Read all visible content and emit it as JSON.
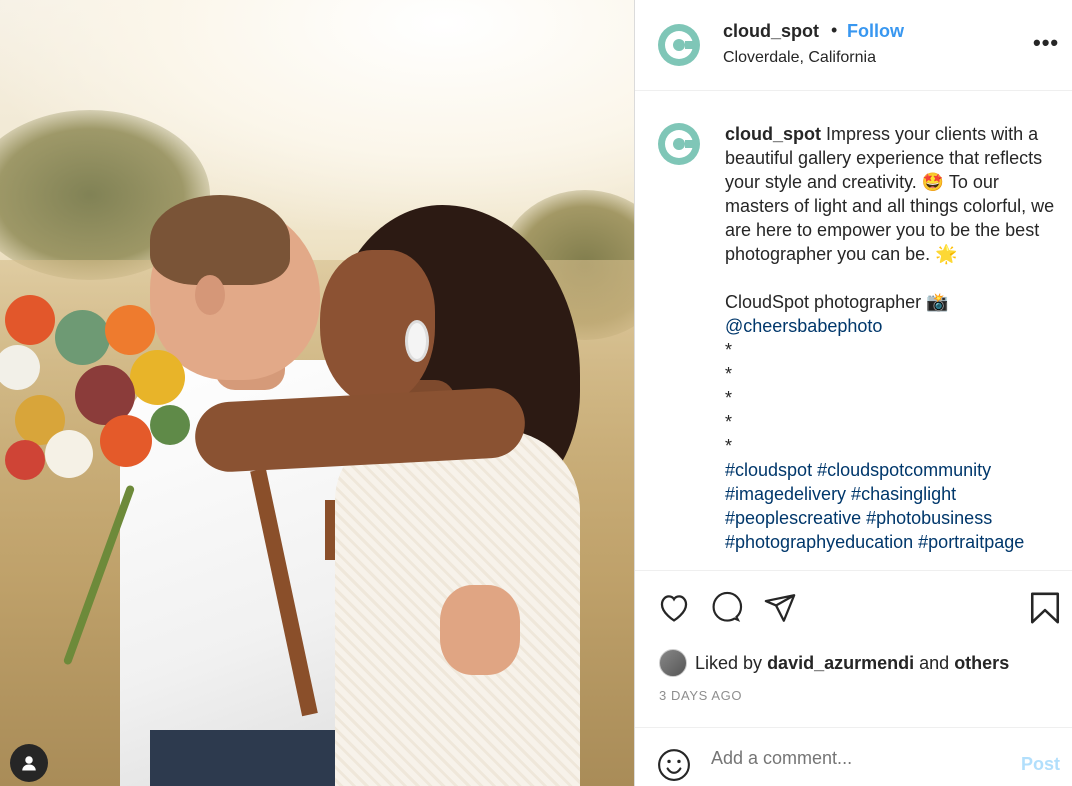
{
  "post": {
    "username": "cloud_spot",
    "separator": "•",
    "follow_label": "Follow",
    "location": "Cloverdale, California",
    "more_label": "•••"
  },
  "caption": {
    "username": "cloud_spot",
    "line1": " Impress your clients with a beautiful gallery experience that reflects your style and creativity. 🤩 To our masters of light and all things colorful, we are here to empower you to be the best photographer you can be. 🌟",
    "credit": "CloudSpot photographer 📸",
    "mention": "@cheersbabephoto",
    "stars": [
      "*",
      "*",
      "*",
      "*",
      "*"
    ],
    "hashtags": [
      "#cloudspot #cloudspotcommunity",
      "#imagedelivery #chasinglight",
      "#peoplescreative #photobusiness",
      "#photographyeducation #portraitpage"
    ]
  },
  "engagement": {
    "liked_by_prefix": "Liked by ",
    "liked_by_user": "david_azurmendi",
    "liked_by_middle": " and ",
    "liked_by_others": "others",
    "timestamp": "3 DAYS AGO"
  },
  "comment": {
    "placeholder": "Add a comment...",
    "post_label": "Post"
  },
  "icons": {
    "like": "heart-icon",
    "comment": "comment-icon",
    "share": "share-icon",
    "save": "bookmark-icon",
    "emoji": "emoji-icon",
    "tagged_user": "user-icon"
  },
  "colors": {
    "follow": "#3897f0",
    "link": "#00376b",
    "post_disabled": "#b2dffc",
    "avatar": "#7fc6b7"
  }
}
